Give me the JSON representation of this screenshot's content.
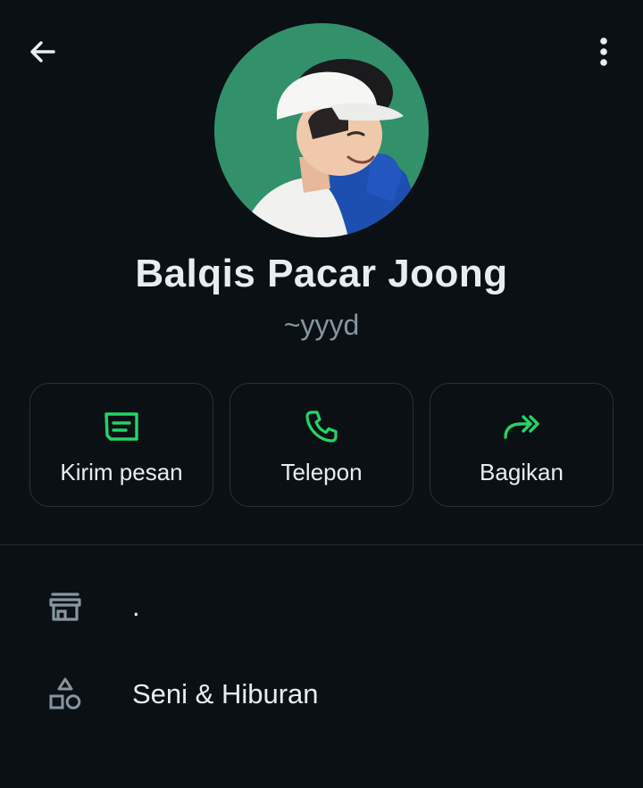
{
  "profile": {
    "name": "Balqis Pacar Joong",
    "handle": "~yyyd"
  },
  "actions": [
    {
      "label": "Kirim pesan",
      "icon": "message-icon"
    },
    {
      "label": "Telepon",
      "icon": "phone-icon"
    },
    {
      "label": "Bagikan",
      "icon": "share-forward-icon"
    }
  ],
  "info": [
    {
      "icon": "store-icon",
      "text": "."
    },
    {
      "icon": "shapes-icon",
      "text": "Seni & Hiburan"
    }
  ],
  "colors": {
    "background": "#0b1014",
    "accent": "#25d366",
    "text_primary": "#e9edef",
    "text_secondary": "#8696a0",
    "border": "#2a3238"
  }
}
